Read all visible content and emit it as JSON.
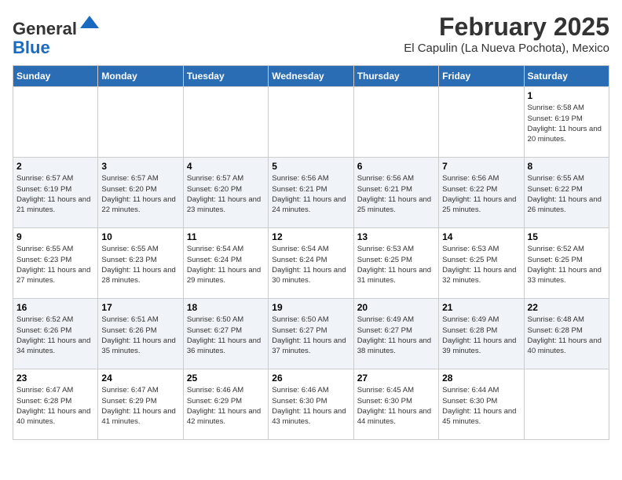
{
  "header": {
    "logo_line1": "General",
    "logo_line2": "Blue",
    "month_title": "February 2025",
    "location": "El Capulin (La Nueva Pochota), Mexico"
  },
  "weekdays": [
    "Sunday",
    "Monday",
    "Tuesday",
    "Wednesday",
    "Thursday",
    "Friday",
    "Saturday"
  ],
  "weeks": [
    [
      {
        "day": "",
        "info": ""
      },
      {
        "day": "",
        "info": ""
      },
      {
        "day": "",
        "info": ""
      },
      {
        "day": "",
        "info": ""
      },
      {
        "day": "",
        "info": ""
      },
      {
        "day": "",
        "info": ""
      },
      {
        "day": "1",
        "info": "Sunrise: 6:58 AM\nSunset: 6:19 PM\nDaylight: 11 hours and 20 minutes."
      }
    ],
    [
      {
        "day": "2",
        "info": "Sunrise: 6:57 AM\nSunset: 6:19 PM\nDaylight: 11 hours and 21 minutes."
      },
      {
        "day": "3",
        "info": "Sunrise: 6:57 AM\nSunset: 6:20 PM\nDaylight: 11 hours and 22 minutes."
      },
      {
        "day": "4",
        "info": "Sunrise: 6:57 AM\nSunset: 6:20 PM\nDaylight: 11 hours and 23 minutes."
      },
      {
        "day": "5",
        "info": "Sunrise: 6:56 AM\nSunset: 6:21 PM\nDaylight: 11 hours and 24 minutes."
      },
      {
        "day": "6",
        "info": "Sunrise: 6:56 AM\nSunset: 6:21 PM\nDaylight: 11 hours and 25 minutes."
      },
      {
        "day": "7",
        "info": "Sunrise: 6:56 AM\nSunset: 6:22 PM\nDaylight: 11 hours and 25 minutes."
      },
      {
        "day": "8",
        "info": "Sunrise: 6:55 AM\nSunset: 6:22 PM\nDaylight: 11 hours and 26 minutes."
      }
    ],
    [
      {
        "day": "9",
        "info": "Sunrise: 6:55 AM\nSunset: 6:23 PM\nDaylight: 11 hours and 27 minutes."
      },
      {
        "day": "10",
        "info": "Sunrise: 6:55 AM\nSunset: 6:23 PM\nDaylight: 11 hours and 28 minutes."
      },
      {
        "day": "11",
        "info": "Sunrise: 6:54 AM\nSunset: 6:24 PM\nDaylight: 11 hours and 29 minutes."
      },
      {
        "day": "12",
        "info": "Sunrise: 6:54 AM\nSunset: 6:24 PM\nDaylight: 11 hours and 30 minutes."
      },
      {
        "day": "13",
        "info": "Sunrise: 6:53 AM\nSunset: 6:25 PM\nDaylight: 11 hours and 31 minutes."
      },
      {
        "day": "14",
        "info": "Sunrise: 6:53 AM\nSunset: 6:25 PM\nDaylight: 11 hours and 32 minutes."
      },
      {
        "day": "15",
        "info": "Sunrise: 6:52 AM\nSunset: 6:25 PM\nDaylight: 11 hours and 33 minutes."
      }
    ],
    [
      {
        "day": "16",
        "info": "Sunrise: 6:52 AM\nSunset: 6:26 PM\nDaylight: 11 hours and 34 minutes."
      },
      {
        "day": "17",
        "info": "Sunrise: 6:51 AM\nSunset: 6:26 PM\nDaylight: 11 hours and 35 minutes."
      },
      {
        "day": "18",
        "info": "Sunrise: 6:50 AM\nSunset: 6:27 PM\nDaylight: 11 hours and 36 minutes."
      },
      {
        "day": "19",
        "info": "Sunrise: 6:50 AM\nSunset: 6:27 PM\nDaylight: 11 hours and 37 minutes."
      },
      {
        "day": "20",
        "info": "Sunrise: 6:49 AM\nSunset: 6:27 PM\nDaylight: 11 hours and 38 minutes."
      },
      {
        "day": "21",
        "info": "Sunrise: 6:49 AM\nSunset: 6:28 PM\nDaylight: 11 hours and 39 minutes."
      },
      {
        "day": "22",
        "info": "Sunrise: 6:48 AM\nSunset: 6:28 PM\nDaylight: 11 hours and 40 minutes."
      }
    ],
    [
      {
        "day": "23",
        "info": "Sunrise: 6:47 AM\nSunset: 6:28 PM\nDaylight: 11 hours and 40 minutes."
      },
      {
        "day": "24",
        "info": "Sunrise: 6:47 AM\nSunset: 6:29 PM\nDaylight: 11 hours and 41 minutes."
      },
      {
        "day": "25",
        "info": "Sunrise: 6:46 AM\nSunset: 6:29 PM\nDaylight: 11 hours and 42 minutes."
      },
      {
        "day": "26",
        "info": "Sunrise: 6:46 AM\nSunset: 6:30 PM\nDaylight: 11 hours and 43 minutes."
      },
      {
        "day": "27",
        "info": "Sunrise: 6:45 AM\nSunset: 6:30 PM\nDaylight: 11 hours and 44 minutes."
      },
      {
        "day": "28",
        "info": "Sunrise: 6:44 AM\nSunset: 6:30 PM\nDaylight: 11 hours and 45 minutes."
      },
      {
        "day": "",
        "info": ""
      }
    ]
  ]
}
